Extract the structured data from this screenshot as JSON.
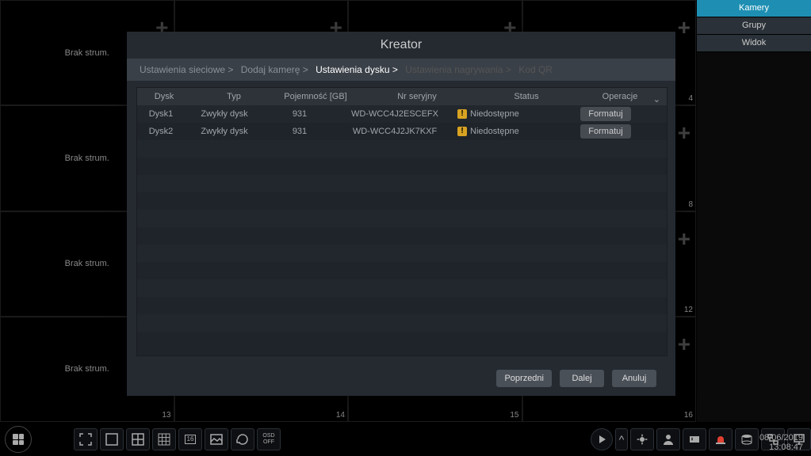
{
  "grid": {
    "no_stream_label": "Brak strum.",
    "cells": [
      {
        "num": ""
      },
      {
        "num": ""
      },
      {
        "num": ""
      },
      {
        "num": "4"
      },
      {
        "num": ""
      },
      {
        "num": ""
      },
      {
        "num": ""
      },
      {
        "num": "8"
      },
      {
        "num": ""
      },
      {
        "num": ""
      },
      {
        "num": ""
      },
      {
        "num": "12"
      },
      {
        "num": "13"
      },
      {
        "num": "14"
      },
      {
        "num": "15"
      },
      {
        "num": "16"
      }
    ]
  },
  "right_panel": {
    "tabs": [
      {
        "label": "Kamery",
        "active": true
      },
      {
        "label": "Grupy",
        "active": false
      },
      {
        "label": "Widok",
        "active": false
      }
    ]
  },
  "modal": {
    "title": "Kreator",
    "breadcrumbs": [
      {
        "label": "Ustawienia sieciowe >",
        "state": "normal"
      },
      {
        "label": "Dodaj kamerę >",
        "state": "normal"
      },
      {
        "label": "Ustawienia dysku >",
        "state": "active"
      },
      {
        "label": "Ustawienia nagrywania >",
        "state": "disabled"
      },
      {
        "label": "Kod QR",
        "state": "disabled"
      }
    ],
    "table": {
      "headers": {
        "disk": "Dysk",
        "type": "Typ",
        "capacity": "Pojemność [GB]",
        "serial": "Nr seryjny",
        "status": "Status",
        "operations": "Operacje"
      },
      "rows": [
        {
          "disk": "Dysk1",
          "type": "Zwykły dysk",
          "capacity": "931",
          "serial": "WD-WCC4J2ESCEFX",
          "status": "Niedostępne",
          "format": "Formatuj"
        },
        {
          "disk": "Dysk2",
          "type": "Zwykły dysk",
          "capacity": "931",
          "serial": "WD-WCC4J2JK7KXF",
          "status": "Niedostępne",
          "format": "Formatuj"
        }
      ]
    },
    "footer": {
      "prev": "Poprzedni",
      "next": "Dalej",
      "cancel": "Anuluj"
    }
  },
  "datetime": {
    "date": "08/06/2019",
    "time": "13:08:47"
  },
  "osd_off": "OSD\nOFF"
}
